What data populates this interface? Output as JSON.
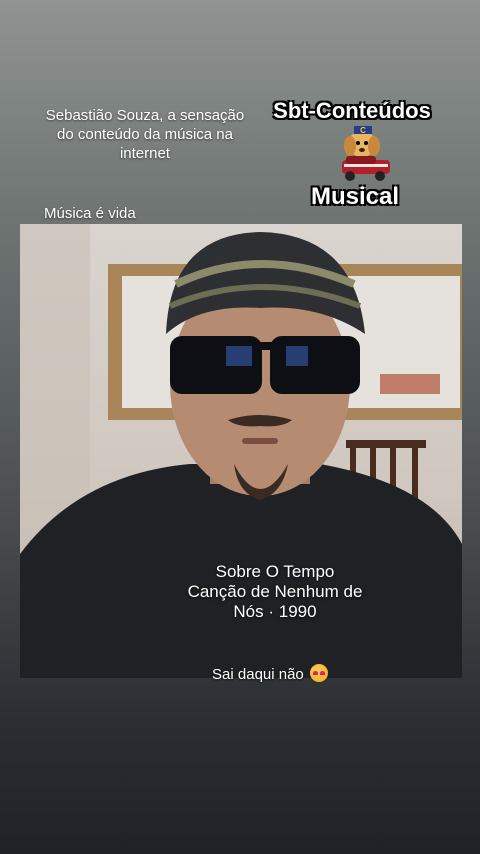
{
  "overlay": {
    "top_caption": "Sebastião Souza, a sensação do conteúdo da música na internet",
    "left_caption": "Música é vida",
    "brand_title": "Sbt-Conteúdos",
    "brand_subtitle": "Musical"
  },
  "video": {
    "song_caption": "Sobre O Tempo\nCanção de Nenhum de\nNós · 1990",
    "bottom_caption": "Sai daqui não",
    "emoji": "smiling-face-with-hearts-icon"
  },
  "colors": {
    "background_top": "#8f9492",
    "background_bottom": "#1f2226",
    "text": "#ffffff"
  }
}
